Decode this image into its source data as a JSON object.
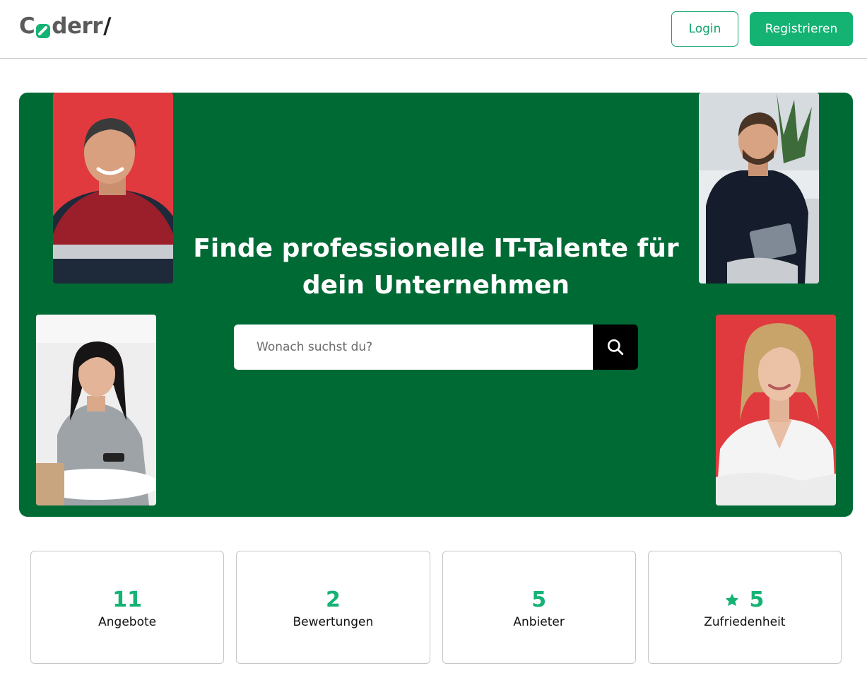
{
  "header": {
    "logo_text_start": "C",
    "logo_text_end": "derr",
    "logo_slash": "/",
    "login_label": "Login",
    "register_label": "Registrieren"
  },
  "hero": {
    "title": "Finde professionelle IT-Talente für dein Unternehmen",
    "search_placeholder": "Wonach suchst du?",
    "search_icon": "search-icon",
    "background_color": "#006a35"
  },
  "stats": [
    {
      "value": "11",
      "label": "Angebote"
    },
    {
      "value": "2",
      "label": "Bewertungen"
    },
    {
      "value": "5",
      "label": "Anbieter"
    },
    {
      "value": "5",
      "label": "Zufriedenheit",
      "icon": "star-icon"
    }
  ],
  "colors": {
    "accent": "#14b273",
    "hero": "#006a35",
    "photo_red": "#e03a3e"
  }
}
